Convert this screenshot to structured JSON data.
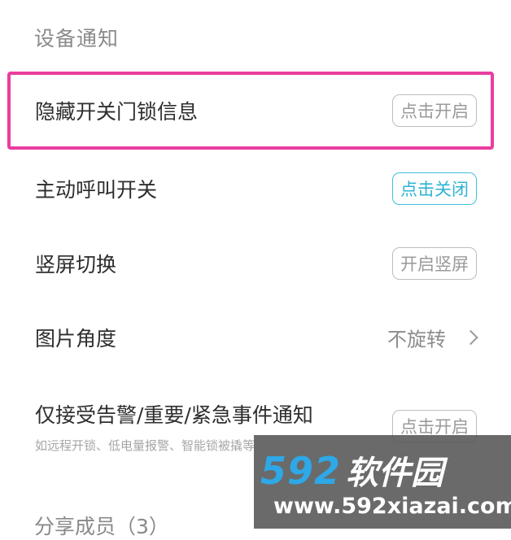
{
  "section_device_notify": "设备通知",
  "rows": [
    {
      "label": "隐藏开关门锁信息",
      "button": "点击开启"
    },
    {
      "label": "主动呼叫开关",
      "button": "点击关闭"
    },
    {
      "label": "竖屏切换",
      "button": "开启竖屏"
    },
    {
      "label": "图片角度",
      "value": "不旋转"
    },
    {
      "label": "仅接受告警/重要/紧急事件通知",
      "sublabel": "如远程开锁、低电量报警、智能锁被撬等",
      "button": "点击开启"
    }
  ],
  "section_share_members": "分享成员（3）",
  "watermark": {
    "number": "592",
    "name": "软件园",
    "url": "www.592xiazai.com"
  },
  "colors": {
    "highlight": "#ea3d9f",
    "active_button": "#2eb3d4",
    "watermark_blue": "#2ea8e6"
  }
}
